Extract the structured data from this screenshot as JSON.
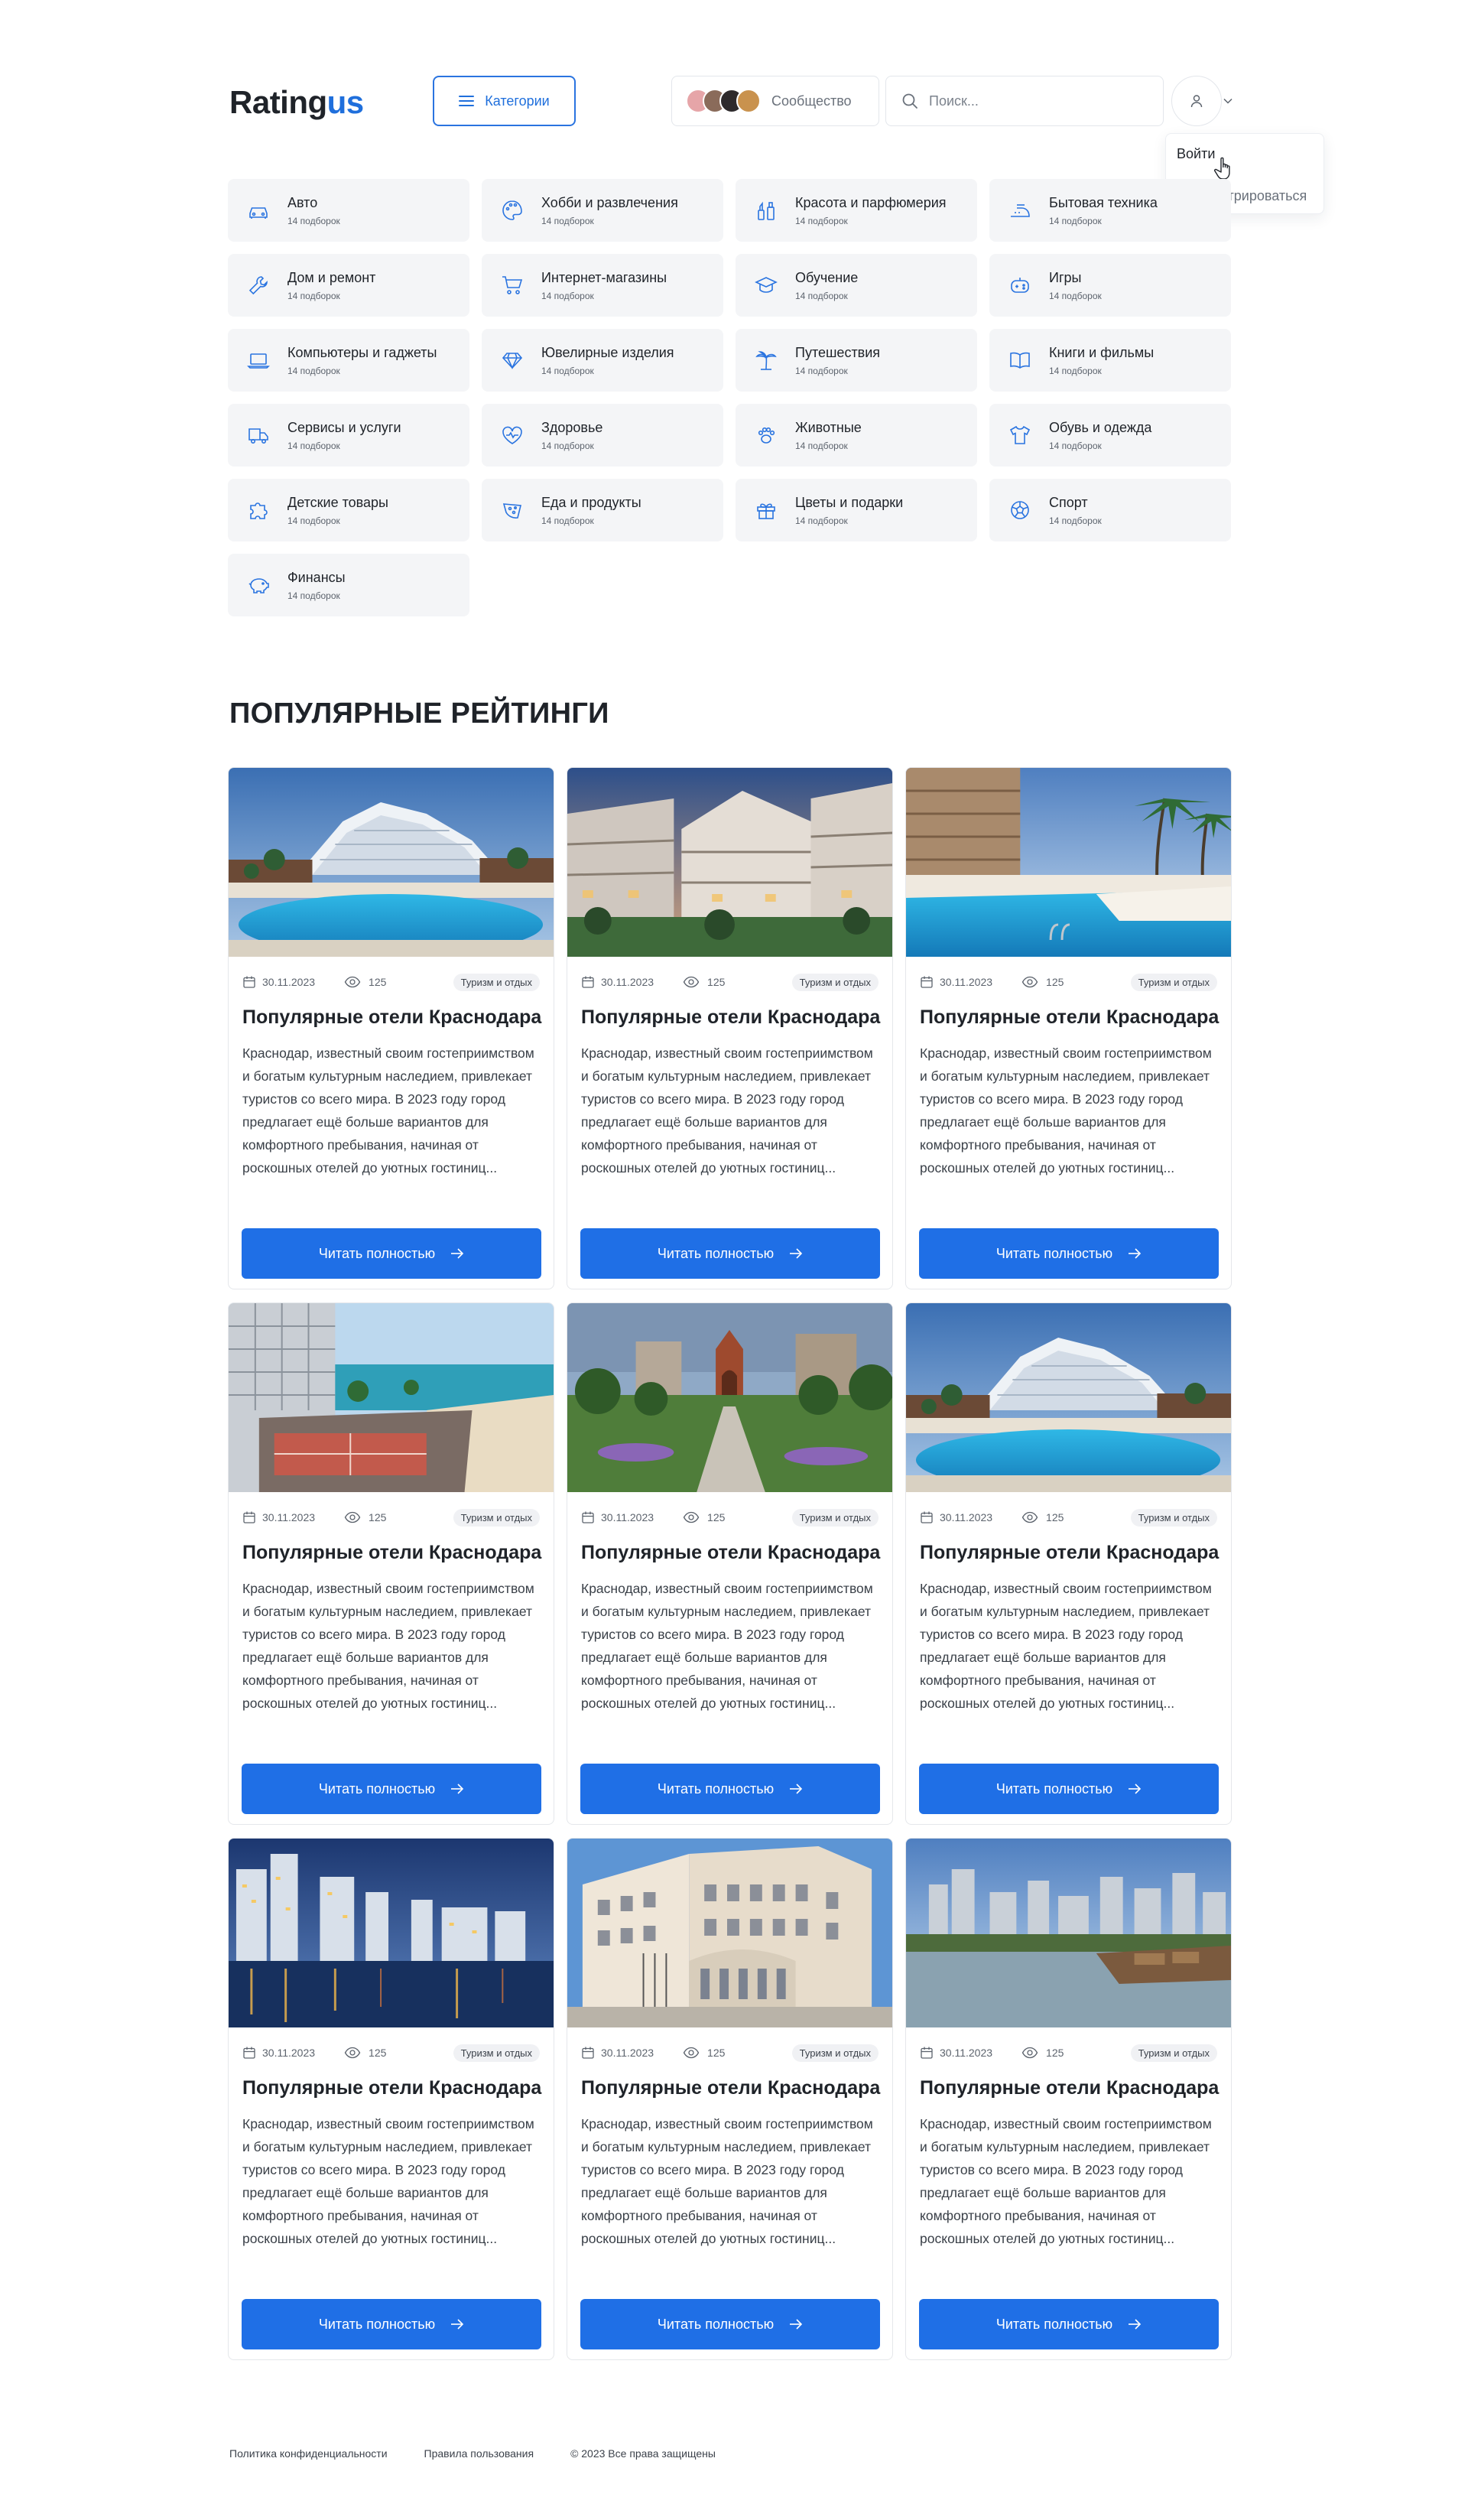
{
  "header": {
    "logo_main": "Rating",
    "logo_accent": "us",
    "categories_label": "Категории",
    "community_label": "Сообщество",
    "search_placeholder": "Поиск...",
    "menu": {
      "login": "Войти",
      "register": "Зарегистрироваться"
    }
  },
  "colors": {
    "accent": "#1f6fe6",
    "tile_bg": "#f4f5f7",
    "text": "#1f2329"
  },
  "categories": [
    {
      "label": "Авто",
      "count": "14 подборок",
      "icon": "car-icon"
    },
    {
      "label": "Хобби и развлечения",
      "count": "14 подборок",
      "icon": "palette-icon"
    },
    {
      "label": "Красота и парфюмерия",
      "count": "14 подборок",
      "icon": "cosmetics-icon"
    },
    {
      "label": "Бытовая техника",
      "count": "14 подборок",
      "icon": "iron-icon"
    },
    {
      "label": "Дом и ремонт",
      "count": "14 подборок",
      "icon": "wrench-icon"
    },
    {
      "label": "Интернет-магазины",
      "count": "14 подборок",
      "icon": "cart-icon"
    },
    {
      "label": "Обучение",
      "count": "14 подборок",
      "icon": "graduation-cap-icon"
    },
    {
      "label": "Игры",
      "count": "14 подборок",
      "icon": "gamepad-icon"
    },
    {
      "label": "Компьютеры и гаджеты",
      "count": "14 подборок",
      "icon": "laptop-icon"
    },
    {
      "label": "Ювелирные изделия",
      "count": "14 подборок",
      "icon": "diamond-icon"
    },
    {
      "label": "Путешествия",
      "count": "14 подборок",
      "icon": "palm-tree-icon"
    },
    {
      "label": "Книги и фильмы",
      "count": "14 подборок",
      "icon": "book-icon"
    },
    {
      "label": "Сервисы и услуги",
      "count": "14 подборок",
      "icon": "truck-icon"
    },
    {
      "label": "Здоровье",
      "count": "14 подборок",
      "icon": "heart-pulse-icon"
    },
    {
      "label": "Животные",
      "count": "14 подборок",
      "icon": "paw-icon"
    },
    {
      "label": "Обувь и одежда",
      "count": "14 подборок",
      "icon": "tshirt-icon"
    },
    {
      "label": "Детские товары",
      "count": "14 подборок",
      "icon": "puzzle-icon"
    },
    {
      "label": "Еда и продукты",
      "count": "14 подборок",
      "icon": "food-icon"
    },
    {
      "label": "Цветы и подарки",
      "count": "14 подборок",
      "icon": "gift-icon"
    },
    {
      "label": "Спорт",
      "count": "14 подборок",
      "icon": "football-icon"
    },
    {
      "label": "Финансы",
      "count": "14 подборок",
      "icon": "piggy-bank-icon"
    }
  ],
  "section_title": "ПОПУЛЯРНЫЕ РЕЙТИНГИ",
  "cards": [
    {
      "date": "30.11.2023",
      "views": "125",
      "tag": "Туризм и отдых",
      "title": "Популярные отели Краснодара",
      "text": "Краснодар, известный своим гостеприимством и богатым культурным наследием, привлекает туристов со всего мира. В 2023 году город предлагает ещё больше вариантов для комфортного пребывания, начиная от роскошных отелей до уютных гостиниц...",
      "button": "Читать полностью",
      "image": "resort-pool-photo"
    },
    {
      "date": "30.11.2023",
      "views": "125",
      "tag": "Туризм и отдых",
      "title": "Популярные отели Краснодара",
      "text": "Краснодар, известный своим гостеприимством и богатым культурным наследием, привлекает туристов со всего мира. В 2023 году город предлагает ещё больше вариантов для комфортного пребывания, начиная от роскошных отелей до уютных гостиниц...",
      "button": "Читать полностью",
      "image": "hotel-evening-photo"
    },
    {
      "date": "30.11.2023",
      "views": "125",
      "tag": "Туризм и отдых",
      "title": "Популярные отели Краснодара",
      "text": "Краснодар, известный своим гостеприимством и богатым культурным наследием, привлекает туристов со всего мира. В 2023 году город предлагает ещё больше вариантов для комфортного пребывания, начиная от роскошных отелей до уютных гостиниц...",
      "button": "Читать полностью",
      "image": "pool-palms-photo"
    },
    {
      "date": "30.11.2023",
      "views": "125",
      "tag": "Туризм и отдых",
      "title": "Популярные отели Краснодара",
      "text": "Краснодар, известный своим гостеприимством и богатым культурным наследием, привлекает туристов со всего мира. В 2023 году город предлагает ещё больше вариантов для комфортного пребывания, начиная от роскошных отелей до уютных гостиниц...",
      "button": "Читать полностью",
      "image": "seaside-terrace-photo"
    },
    {
      "date": "30.11.2023",
      "views": "125",
      "tag": "Туризм и отдых",
      "title": "Популярные отели Краснодара",
      "text": "Краснодар, известный своим гостеприимством и богатым культурным наследием, привлекает туристов со всего мира. В 2023 году город предлагает ещё больше вариантов для комфортного пребывания, начиная от роскошных отелей до уютных гостиниц...",
      "button": "Читать полностью",
      "image": "city-park-photo"
    },
    {
      "date": "30.11.2023",
      "views": "125",
      "tag": "Туризм и отдых",
      "title": "Популярные отели Краснодара",
      "text": "Краснодар, известный своим гостеприимством и богатым культурным наследием, привлекает туристов со всего мира. В 2023 году город предлагает ещё больше вариантов для комфортного пребывания, начиная от роскошных отелей до уютных гостиниц...",
      "button": "Читать полностью",
      "image": "resort-pool-photo"
    },
    {
      "date": "30.11.2023",
      "views": "125",
      "tag": "Туризм и отдых",
      "title": "Популярные отели Краснодара",
      "text": "Краснодар, известный своим гостеприимством и богатым культурным наследием, привлекает туристов со всего мира. В 2023 году город предлагает ещё больше вариантов для комфортного пребывания, начиная от роскошных отелей до уютных гостиниц...",
      "button": "Читать полностью",
      "image": "night-skyline-photo"
    },
    {
      "date": "30.11.2023",
      "views": "125",
      "tag": "Туризм и отдых",
      "title": "Популярные отели Краснодара",
      "text": "Краснодар, известный своим гостеприимством и богатым культурным наследием, привлекает туристов со всего мира. В 2023 году город предлагает ещё больше вариантов для комфортного пребывания, начиная от роскошных отелей до уютных гостиниц...",
      "button": "Читать полностью",
      "image": "congress-hotel-photo"
    },
    {
      "date": "30.11.2023",
      "views": "125",
      "tag": "Туризм и отдых",
      "title": "Популярные отели Краснодара",
      "text": "Краснодар, известный своим гостеприимством и богатым культурным наследием, привлекает туристов со всего мира. В 2023 году город предлагает ещё больше вариантов для комфортного пребывания, начиная от роскошных отелей до уютных гостиниц...",
      "button": "Читать полностью",
      "image": "river-city-photo"
    }
  ],
  "footer": {
    "privacy": "Политика конфиденциальности",
    "terms": "Правила пользования",
    "copyright": "© 2023 Все права защищены"
  }
}
